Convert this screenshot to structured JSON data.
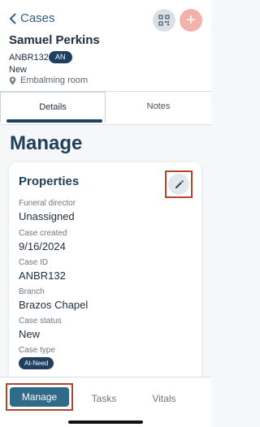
{
  "header": {
    "back_label": "Cases",
    "case_name": "Samuel Perkins",
    "case_id": "ANBR132",
    "case_badge": "AN",
    "status": "New",
    "location": "Embalming room"
  },
  "tabs": [
    {
      "label": "Details",
      "active": true
    },
    {
      "label": "Notes",
      "active": false
    }
  ],
  "section": {
    "title": "Manage"
  },
  "properties": {
    "title": "Properties",
    "fields": [
      {
        "label": "Funeral director",
        "value": "Unassigned"
      },
      {
        "label": "Case created",
        "value": "9/16/2024"
      },
      {
        "label": "Case ID",
        "value": "ANBR132"
      },
      {
        "label": "Branch",
        "value": "Brazos Chapel"
      },
      {
        "label": "Case status",
        "value": "New"
      },
      {
        "label": "Case type",
        "value": "At-Need"
      }
    ]
  },
  "bottom_nav": [
    {
      "label": "Manage",
      "active": true
    },
    {
      "label": "Tasks",
      "active": false
    },
    {
      "label": "Vitals",
      "active": false
    }
  ],
  "icons": {
    "back": "chevron-left-icon",
    "qr": "qr-code-icon",
    "add": "plus-icon",
    "location": "location-pin-icon",
    "edit": "pencil-icon"
  },
  "colors": {
    "primary": "#1e3f5e",
    "accent": "#2f6a88",
    "add_button": "#f3b1ac",
    "highlight_frame": "#b0452c"
  }
}
